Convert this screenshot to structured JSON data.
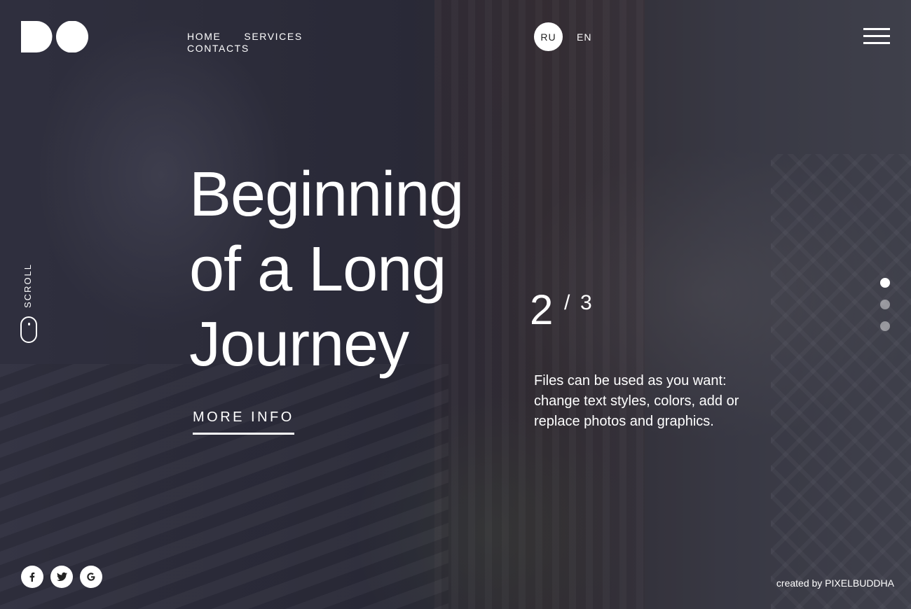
{
  "nav": {
    "items": [
      {
        "label": "HOME"
      },
      {
        "label": "SERVICES"
      },
      {
        "label": "CONTACTS"
      }
    ]
  },
  "language": {
    "active": "RU",
    "other": "EN"
  },
  "sidebar": {
    "scroll_label": "SCROLL"
  },
  "hero": {
    "title_lines": [
      "Beginning",
      "of a Long",
      "Journey"
    ],
    "cta_label": "MORE INFO"
  },
  "slider": {
    "current": "2",
    "separator": "/",
    "total": "3",
    "description": "Files can be used as you want: change text styles, colors, add or replace photos and graphics.",
    "dots": [
      {
        "active": true
      },
      {
        "active": false
      },
      {
        "active": false
      }
    ]
  },
  "social": {
    "icons": [
      {
        "name": "facebook-icon",
        "glyph": "f"
      },
      {
        "name": "twitter-icon",
        "glyph": "t"
      },
      {
        "name": "google-icon",
        "glyph": "G"
      }
    ]
  },
  "footer": {
    "credit": "created by PIXELBUDDHA"
  },
  "colors": {
    "overlay": "#23232f",
    "text": "#ffffff"
  }
}
